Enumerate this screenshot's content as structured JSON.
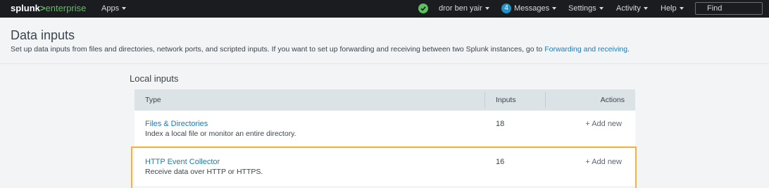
{
  "topbar": {
    "logo_main": "splunk",
    "logo_gt": ">",
    "logo_product": "enterprise",
    "apps_label": "Apps",
    "user_label": "dror ben yair",
    "messages_count": "4",
    "messages_label": "Messages",
    "settings_label": "Settings",
    "activity_label": "Activity",
    "help_label": "Help",
    "find_placeholder": "Find",
    "status_color": "#5cc05c"
  },
  "header": {
    "title": "Data inputs",
    "description": "Set up data inputs from files and directories, network ports, and scripted inputs. If you want to set up forwarding and receiving between two Splunk instances, go to",
    "link_text": "Forwarding and receiving",
    "period": "."
  },
  "local_inputs": {
    "section_title": "Local inputs",
    "columns": {
      "type": "Type",
      "inputs": "Inputs",
      "actions": "Actions"
    },
    "rows": [
      {
        "name": "Files & Directories",
        "description": "Index a local file or monitor an entire directory.",
        "inputs": "18",
        "action": "Add new"
      },
      {
        "name": "HTTP Event Collector",
        "description": "Receive data over HTTP or HTTPS.",
        "inputs": "16",
        "action": "Add new"
      }
    ],
    "highlight_color": "#f5b331"
  }
}
